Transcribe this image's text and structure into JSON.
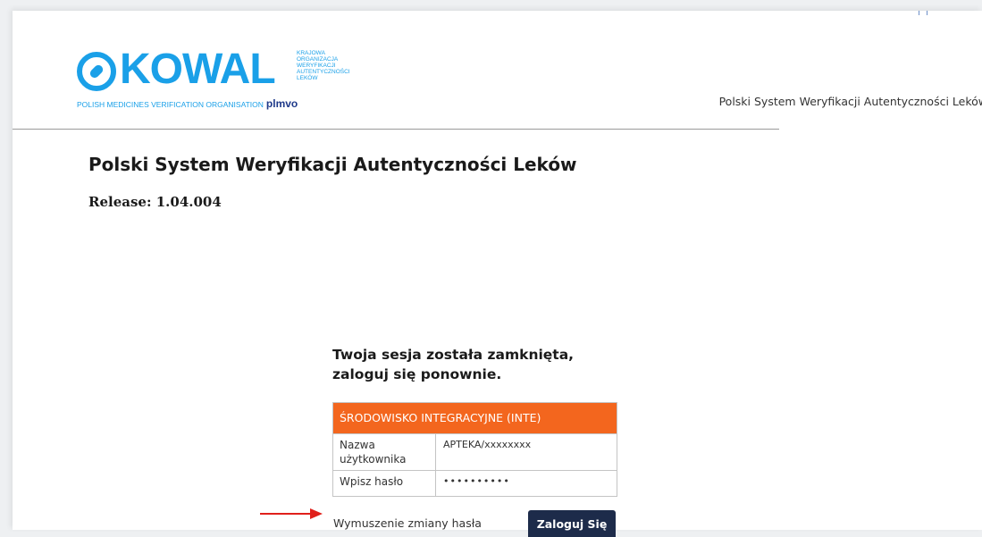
{
  "logo": {
    "word": "KOWAL",
    "side_lines": [
      "KRAJOWA",
      "ORGANIZACJA",
      "WERYFIKACJI",
      "AUTENTYCZNOŚCI",
      "LEKÓW"
    ],
    "subtitle": "POLISH MEDICINES VERIFICATION ORGANISATION",
    "subtitle_brand": "plmvo"
  },
  "header": {
    "system_name": "Polski System Weryfikacji Autentyczności Leków"
  },
  "main": {
    "title": "Polski System Weryfikacji Autentyczności Leków",
    "release": "Release: 1.04.004"
  },
  "session": {
    "line1": "Twoja sesja została zamknięta,",
    "line2": "zaloguj się ponownie."
  },
  "login_form": {
    "environment": "ŚRODOWISKO INTEGRACYJNE (INTE)",
    "username_label": "Nazwa użytkownika",
    "username_value": "APTEKA/xxxxxxxx",
    "password_label": "Wpisz hasło",
    "password_value": "••••••••••",
    "force_change_label": "Wymuszenie zmiany hasła",
    "submit_label": "Zaloguj Się"
  },
  "colors": {
    "brand_blue": "#1aa0e8",
    "env_orange": "#f3661e",
    "button_navy": "#1d2b4a",
    "arrow_red": "#e0201b"
  }
}
